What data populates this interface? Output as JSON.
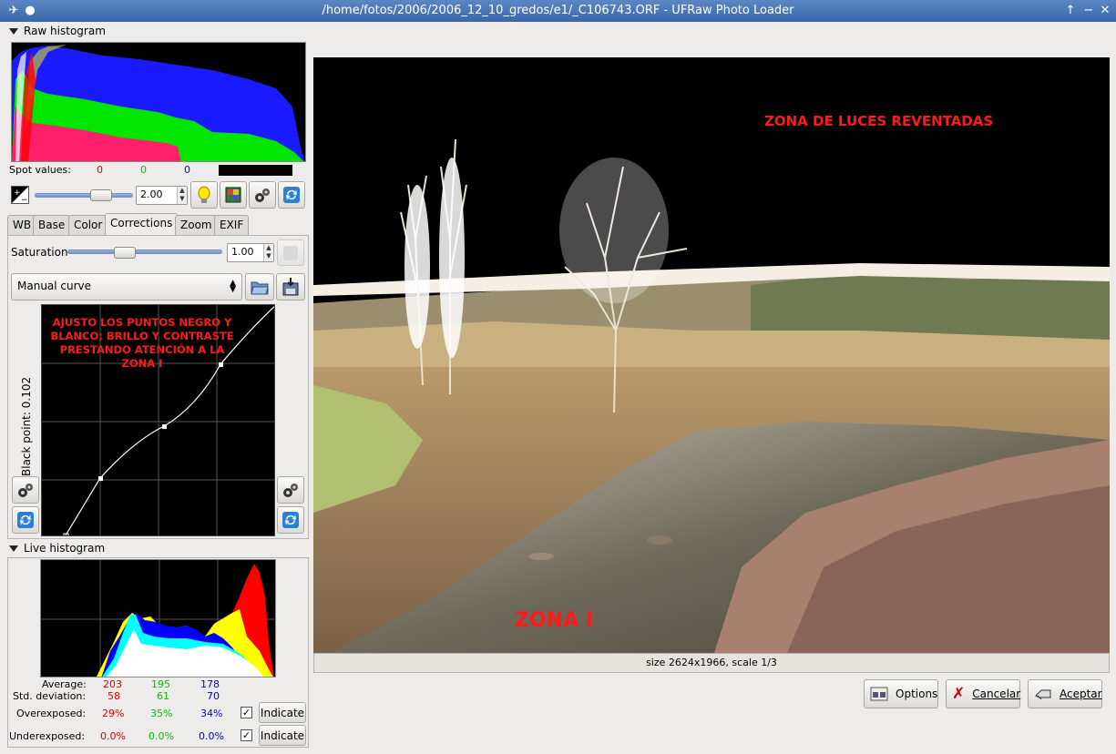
{
  "window": {
    "title": "/home/fotos/2006/2006_12_10_gredos/e1/_C106743.ORF - UFRaw Photo Loader"
  },
  "raw_histogram": {
    "label": "Raw histogram",
    "spot_label": "Spot values:",
    "spot_r": "0",
    "spot_g": "0",
    "spot_b": "0"
  },
  "exposure": {
    "value": "2.00",
    "slider_fraction": 0.73
  },
  "tabs": [
    {
      "label": "WB"
    },
    {
      "label": "Base"
    },
    {
      "label": "Color"
    },
    {
      "label": "Corrections"
    },
    {
      "label": "Zoom"
    },
    {
      "label": "EXIF"
    }
  ],
  "corrections": {
    "saturation_label": "Saturation",
    "saturation_value": "1.00",
    "saturation_fraction": 0.35,
    "curve_select": "Manual curve",
    "black_point_label": "Black point: 0.102",
    "curve_annotation": "AJUSTO LOS PUNTOS NEGRO Y BLANCO; BRILLO Y CONTRASTE PRESTANDO ATENCIÓN A LA ZONA I"
  },
  "live_histogram": {
    "label": "Live histogram",
    "average_label": "Average:",
    "avg_r": "203",
    "avg_g": "195",
    "avg_b": "178",
    "std_label": "Std. deviation:",
    "std_r": "58",
    "std_g": "61",
    "std_b": "70",
    "over_label": "Overexposed:",
    "over_r": "29%",
    "over_g": "35%",
    "over_b": "34%",
    "under_label": "Underexposed:",
    "under_r": "0.0%",
    "under_g": "0.0%",
    "under_b": "0.0%",
    "indicate_label": "Indicate",
    "over_checked": "✓",
    "under_checked": "✓"
  },
  "preview": {
    "annotation_top": "ZONA DE LUCES REVENTADAS",
    "annotation_bottom": "ZONA I",
    "status": "size 2624x1966, scale 1/3"
  },
  "buttons": {
    "options": "Options",
    "cancel": "Cancelar",
    "accept": "Aceptar"
  },
  "colors": {
    "red": "#e00000",
    "green": "#00c000",
    "blue": "#0000e0",
    "annotation_red": "#ff1a1a"
  }
}
